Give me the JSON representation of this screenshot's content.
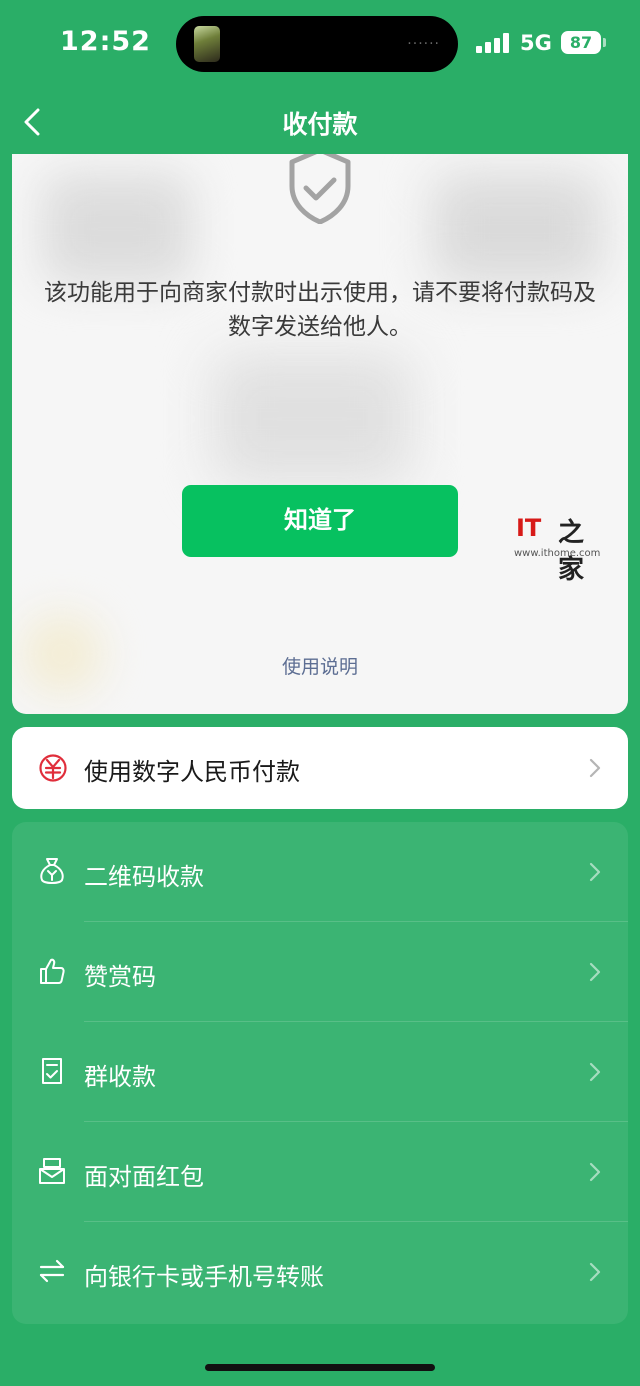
{
  "status_bar": {
    "time": "12:52",
    "network": "5G",
    "battery": "87",
    "island_dots": "······"
  },
  "nav": {
    "title": "收付款"
  },
  "pay_card": {
    "notice": "该功能用于向商家付款时出示使用，请不要将付款码及数字发送给他人。",
    "ok_button": "知道了",
    "help_link": "使用说明",
    "watermark": {
      "logo_it": "IT",
      "logo_zh": "之家",
      "url": "www.ithome.com"
    }
  },
  "digital_rmb": {
    "label": "使用数字人民币付款",
    "icon": "digital-rmb-icon",
    "accent": "#e02e3b"
  },
  "menu": {
    "items": [
      {
        "label": "二维码收款",
        "icon": "money-bag-icon"
      },
      {
        "label": "赞赏码",
        "icon": "thumbs-up-icon"
      },
      {
        "label": "群收款",
        "icon": "group-receipt-icon"
      },
      {
        "label": "面对面红包",
        "icon": "red-packet-icon"
      },
      {
        "label": "向银行卡或手机号转账",
        "icon": "transfer-icon"
      }
    ]
  },
  "colors": {
    "background": "#2aae67",
    "primary_button": "#07c160",
    "menu_card": "#3bb473",
    "link": "#5d6e93"
  }
}
